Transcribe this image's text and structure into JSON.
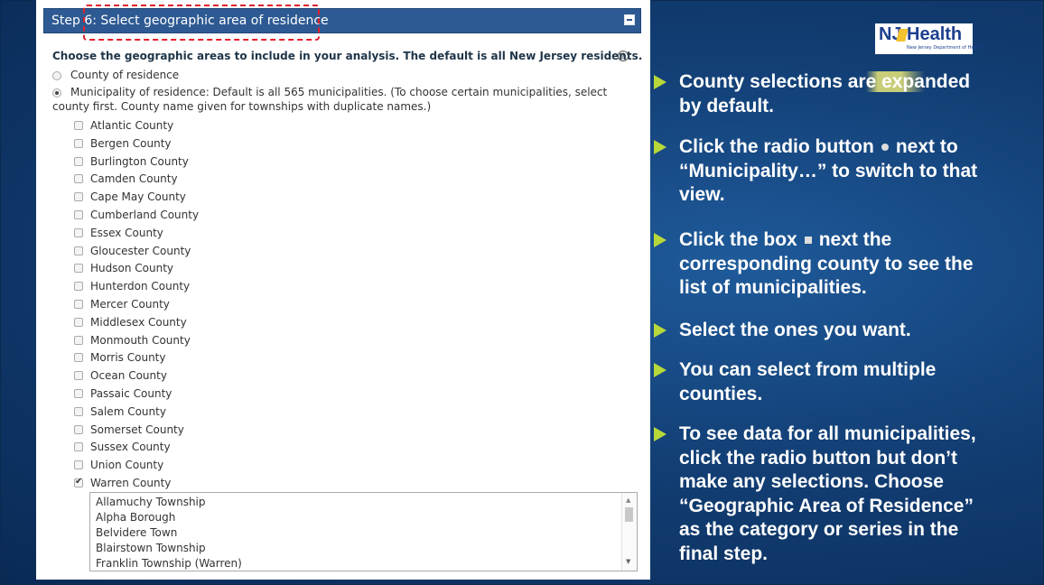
{
  "panel": {
    "title": "Step 6: Select geographic area of residence",
    "instruction": "Choose the geographic areas to include in your analysis. The default is all New Jersey residents.",
    "help_symbol": "?",
    "radio_county_label": "County of residence",
    "radio_muni_label_line1": "Municipality of residence: Default is all 565 municipalities. (To choose certain municipalities, select",
    "radio_muni_label_line2": "county first. County name given for townships with duplicate names.)",
    "counties": [
      {
        "label": "Atlantic County",
        "checked": false
      },
      {
        "label": "Bergen County",
        "checked": false
      },
      {
        "label": "Burlington County",
        "checked": false
      },
      {
        "label": "Camden County",
        "checked": false
      },
      {
        "label": "Cape May County",
        "checked": false
      },
      {
        "label": "Cumberland County",
        "checked": false
      },
      {
        "label": "Essex County",
        "checked": false
      },
      {
        "label": "Gloucester County",
        "checked": false
      },
      {
        "label": "Hudson County",
        "checked": false
      },
      {
        "label": "Hunterdon County",
        "checked": false
      },
      {
        "label": "Mercer County",
        "checked": false
      },
      {
        "label": "Middlesex County",
        "checked": false
      },
      {
        "label": "Monmouth County",
        "checked": false
      },
      {
        "label": "Morris County",
        "checked": false
      },
      {
        "label": "Ocean County",
        "checked": false
      },
      {
        "label": "Passaic County",
        "checked": false
      },
      {
        "label": "Salem County",
        "checked": false
      },
      {
        "label": "Somerset County",
        "checked": false
      },
      {
        "label": "Sussex County",
        "checked": false
      },
      {
        "label": "Union County",
        "checked": false
      },
      {
        "label": "Warren County",
        "checked": true
      }
    ],
    "municipalities": [
      "Allamuchy Township",
      "Alpha Borough",
      "Belvidere Town",
      "Blairstown Township",
      "Franklin Township (Warren)"
    ]
  },
  "logo": {
    "nj": "NJ",
    "health": "Health",
    "subtitle": "New Jersey Department of Health"
  },
  "bullets": {
    "b1_a": "County selections ar",
    "b1_b": "e expa",
    "b1_c": "nded",
    "b1_line2": "by default.",
    "b2_line1": "Click the radio button",
    "b2_line1b": "next to",
    "b2_line2": "“Municipality…” to switch to that",
    "b2_line3": "view.",
    "b3_line1": "Click the box",
    "b3_line1b": "next the",
    "b3_line2": "corresponding county to see the",
    "b3_line3": "list of municipalities.",
    "b4": "Select the ones you want.",
    "b5_line1": "You can select from multiple",
    "b5_line2": "counties.",
    "b6_line1": "To see data for all municipalities,",
    "b6_line2": "click the radio button but don’t",
    "b6_line3": "make any selections.  Choose",
    "b6_line4": "“Geographic Area of Residence”",
    "b6_line5": "as the category or series in the",
    "b6_line6": "final step."
  },
  "colors": {
    "header": "#2d5a93",
    "accent_triangle": "#b8d83a",
    "highlight_dash": "#e0202a"
  }
}
